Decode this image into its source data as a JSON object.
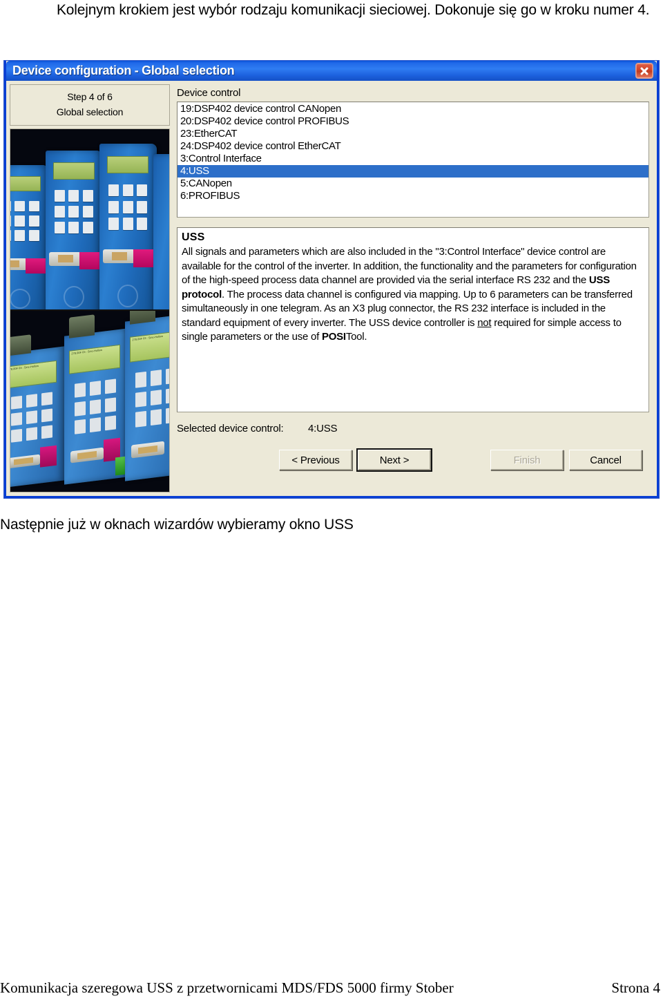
{
  "document": {
    "intro_paragraph": "Kolejnym krokiem jest wybór rodzaju komunikacji sieciowej. Dokonuje się go w kroku numer 4.",
    "caption": "Następnie już w oknach wizardów wybieramy okno USS",
    "footer_text": "Komunikacja szeregowa USS z przetwornicami MDS/FDS 5000 firmy Stober",
    "footer_page": "Strona 4"
  },
  "dialog": {
    "title": "Device configuration - Global selection",
    "close_icon": "close-icon",
    "wizard": {
      "step_line1": "Step 4 of 6",
      "step_line2": "Global selection"
    },
    "device_control_label": "Device control",
    "device_control_items": [
      {
        "label": "19:DSP402 device control CANopen",
        "selected": false
      },
      {
        "label": "20:DSP402 device control PROFIBUS",
        "selected": false
      },
      {
        "label": "23:EtherCAT",
        "selected": false
      },
      {
        "label": "24:DSP402 device control EtherCAT",
        "selected": false
      },
      {
        "label": "3:Control Interface",
        "selected": false
      },
      {
        "label": "4:USS",
        "selected": true
      },
      {
        "label": "5:CANopen",
        "selected": false
      },
      {
        "label": "6:PROFIBUS",
        "selected": false
      }
    ],
    "description": {
      "title": "USS",
      "paragraph_1": "All signals and parameters which are also included in the \"3:Control Interface\" device control are available for the control of the inverter. In addition, the functionality and the parameters for configuration of the high-speed process data channel are provided via the serial interface RS 232 and the ",
      "bold_1": "USS protocol",
      "paragraph_2": ". The process data channel is configured via mapping. Up to 6 parameters can be transferred simultaneously in one telegram. As an X3 plug connector, the RS 232 interface is included in the standard equipment of every inverter. The USS device controller is ",
      "underline_1": "not",
      "paragraph_3": " required for simple access to single parameters or the use of ",
      "bold_2": "POSI",
      "paragraph_4": "Tool."
    },
    "selected_device_control_label": "Selected device control:",
    "selected_device_control_value": "4:USS",
    "buttons": {
      "previous": "< Previous",
      "next": "Next >",
      "finish": "Finish",
      "cancel": "Cancel"
    }
  },
  "colors": {
    "titlebar_blue": "#2f7cf2",
    "dialog_border": "#0a3fd4",
    "dialog_face": "#ece9d8",
    "selection_blue": "#2d6fc9",
    "close_red": "#cf4127"
  },
  "photos": {
    "top_alt": "Blue STOBER inverter keypads row",
    "bottom_alt": "Blue STOBER drive controllers with connectors",
    "lcd_lines": [
      "278.00F",
      "03 : Sinc-Hollow"
    ]
  }
}
